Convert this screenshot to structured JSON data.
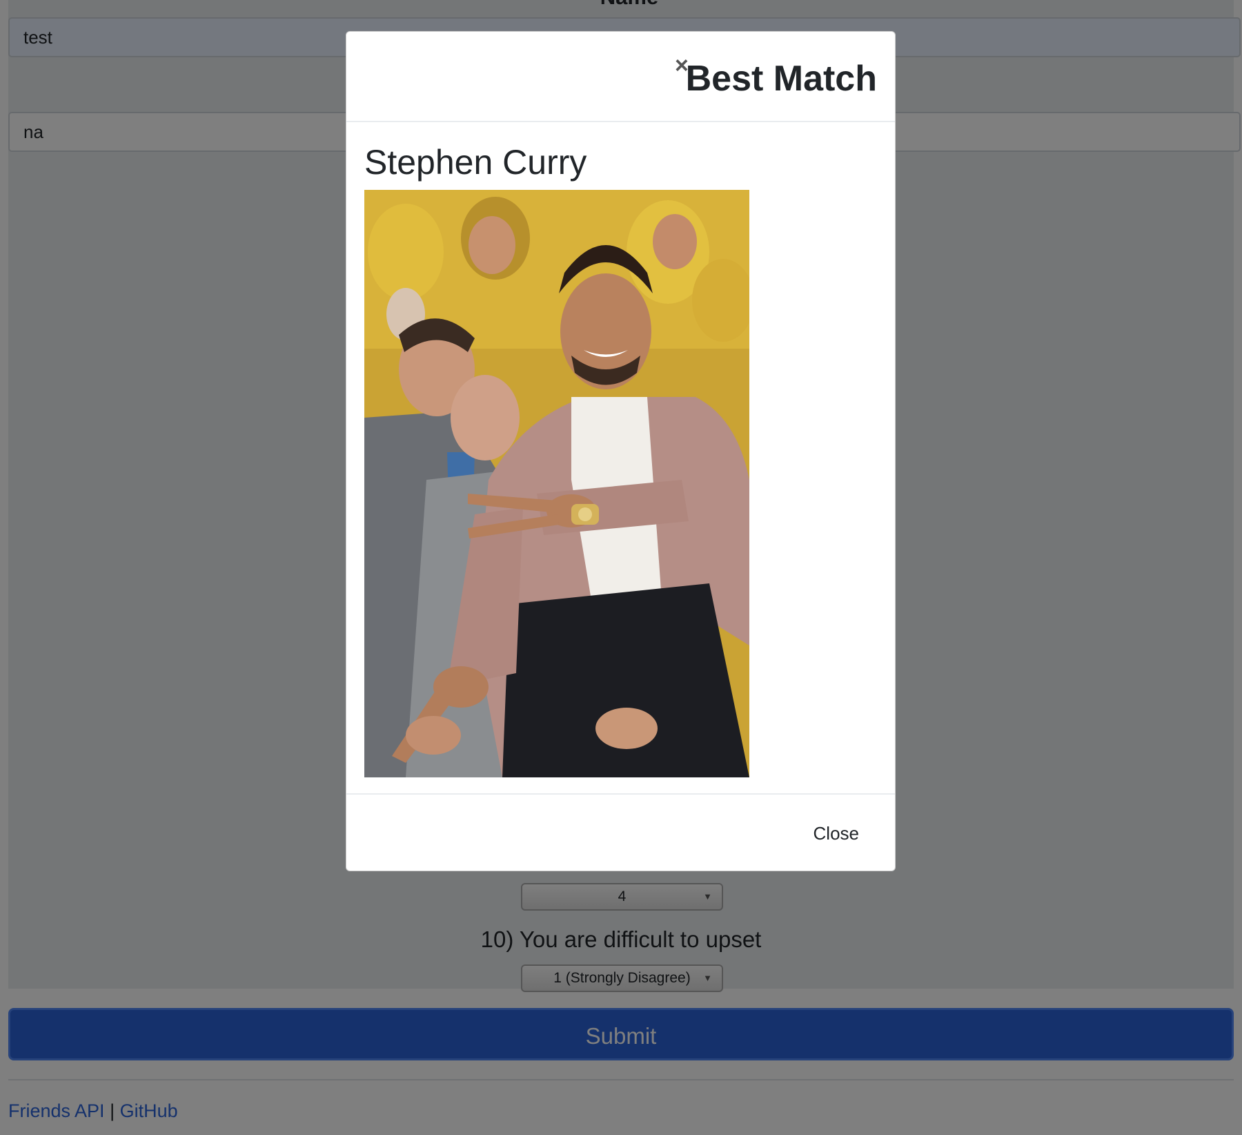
{
  "form": {
    "name_label": "Name",
    "name_value": "test",
    "photo_value": "na",
    "q9_selected": "4",
    "q10_text": "10) You are difficult to upset",
    "q10_selected": "1 (Strongly Disagree)",
    "submit_label": "Submit"
  },
  "footer": {
    "api_link": "Friends API",
    "separator": "|",
    "github_link": "GitHub"
  },
  "modal": {
    "close_x": "×",
    "title": "Best Match",
    "match_name": "Stephen Curry",
    "close_button": "Close"
  },
  "colors": {
    "accent": "#2a62d8",
    "backdrop": "rgba(0,0,0,0.5)"
  }
}
